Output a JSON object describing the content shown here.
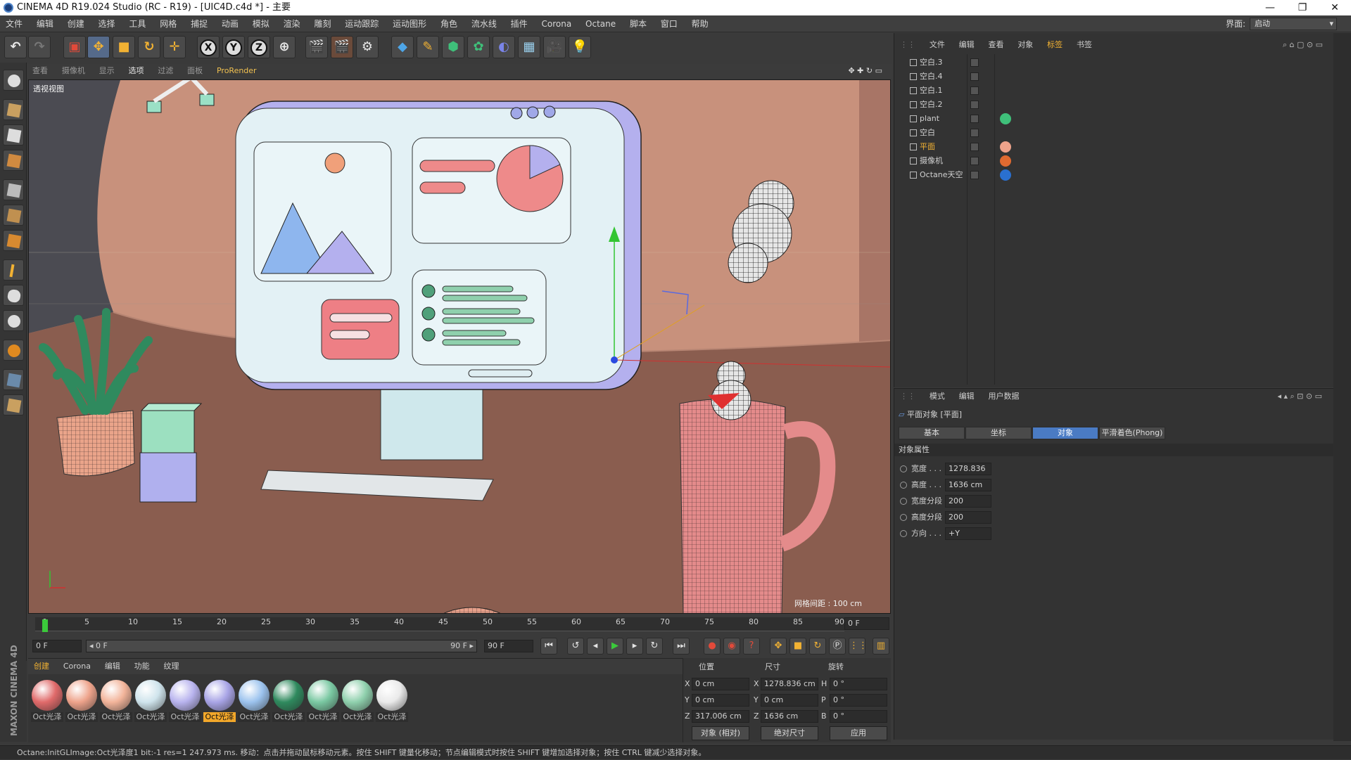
{
  "titlebar": {
    "title": "CINEMA 4D R19.024 Studio (RC - R19) - [UIC4D.c4d *] - 主要",
    "min": "—",
    "restore": "❐",
    "close": "✕"
  },
  "menubar": {
    "items": [
      "文件",
      "编辑",
      "创建",
      "选择",
      "工具",
      "网格",
      "捕捉",
      "动画",
      "模拟",
      "渲染",
      "雕刻",
      "运动跟踪",
      "运动图形",
      "角色",
      "流水线",
      "插件",
      "Corona",
      "Octane",
      "脚本",
      "窗口",
      "帮助"
    ],
    "interface_label": "界面:",
    "interface_value": "启动"
  },
  "toolbar": {
    "x": "X",
    "y": "Y",
    "z": "Z"
  },
  "viewport": {
    "menu": [
      "查看",
      "摄像机",
      "显示",
      "选项",
      "过滤",
      "面板",
      "ProRender"
    ],
    "label": "透视视图",
    "grid_spacing": "网格间距 : 100 cm"
  },
  "timeline": {
    "ticks": [
      "0",
      "5",
      "10",
      "15",
      "20",
      "25",
      "30",
      "35",
      "40",
      "45",
      "50",
      "55",
      "60",
      "65",
      "70",
      "75",
      "80",
      "85",
      "90"
    ],
    "end_field": "0 F"
  },
  "transport": {
    "start": "0 F",
    "range_start": "◂ 0 F",
    "range_end": "90 F ▸",
    "end": "90 F"
  },
  "materials": {
    "menu": [
      "创建",
      "Corona",
      "编辑",
      "功能",
      "纹理"
    ],
    "items": [
      {
        "label": "Oct光泽",
        "color": "#e06a6a",
        "selected": false
      },
      {
        "label": "Oct光泽",
        "color": "#eea38b",
        "selected": false
      },
      {
        "label": "Oct光泽",
        "color": "#f2b49a",
        "selected": false
      },
      {
        "label": "Oct光泽",
        "color": "#cfe4ec",
        "selected": false
      },
      {
        "label": "Oct光泽",
        "color": "#b8b3ee",
        "selected": false
      },
      {
        "label": "Oct光泽",
        "color": "#a8a4e6",
        "selected": true
      },
      {
        "label": "Oct光泽",
        "color": "#9cc3ee",
        "selected": false
      },
      {
        "label": "Oct光泽",
        "color": "#2f8a5e",
        "selected": false
      },
      {
        "label": "Oct光泽",
        "color": "#7ac8a2",
        "selected": false
      },
      {
        "label": "Oct光泽",
        "color": "#8fd0ad",
        "selected": false
      },
      {
        "label": "Oct光泽",
        "color": "#eaeaea",
        "selected": false
      }
    ]
  },
  "coords": {
    "heads": [
      "位置",
      "尺寸",
      "旋转"
    ],
    "rows": [
      {
        "a": "X",
        "pos": "0 cm",
        "b": "X",
        "size": "1278.836 cm",
        "c": "H",
        "rot": "0 °"
      },
      {
        "a": "Y",
        "pos": "0 cm",
        "b": "Y",
        "size": "0 cm",
        "c": "P",
        "rot": "0 °"
      },
      {
        "a": "Z",
        "pos": "317.006 cm",
        "b": "Z",
        "size": "1636 cm",
        "c": "B",
        "rot": "0 °"
      }
    ],
    "mode": "对象 (相对)",
    "size_mode": "绝对尺寸",
    "apply": "应用"
  },
  "objects": {
    "menu": [
      "文件",
      "编辑",
      "查看",
      "对象",
      "标签",
      "书签"
    ],
    "active_menu": "标签",
    "rows": [
      {
        "name": "空白.3",
        "selected": false
      },
      {
        "name": "空白.4",
        "selected": false
      },
      {
        "name": "空白.1",
        "selected": false
      },
      {
        "name": "空白.2",
        "selected": false
      },
      {
        "name": "plant",
        "selected": false
      },
      {
        "name": "空白",
        "selected": false
      },
      {
        "name": "平面",
        "selected": true
      },
      {
        "name": "摄像机",
        "selected": false
      },
      {
        "name": "Octane天空",
        "selected": false
      }
    ]
  },
  "attributes": {
    "menu": [
      "模式",
      "编辑",
      "用户数据"
    ],
    "object": "平面对象 [平面]",
    "tabs": [
      "基本",
      "坐标",
      "对象",
      "平滑着色(Phong)"
    ],
    "active_tab": "对象",
    "section": "对象属性",
    "rows": [
      {
        "label": "宽度 . . .",
        "value": "1278.836"
      },
      {
        "label": "高度 . . .",
        "value": "1636 cm"
      },
      {
        "label": "宽度分段",
        "value": "200"
      },
      {
        "label": "高度分段",
        "value": "200"
      },
      {
        "label": "方向 . . .",
        "value": "+Y"
      }
    ]
  },
  "status": {
    "text": "Octane:InitGLImage:Oct光泽度1  bit:-1 res=1  247.973 ms.    移动：点击并拖动鼠标移动元素。按住 SHIFT 键量化移动；节点编辑模式时按住 SHIFT 键增加选择对象；按住 CTRL 键减少选择对象。"
  },
  "brand": {
    "text": "MAXON CINEMA 4D"
  },
  "colors": {
    "accent": "#f2b233",
    "tab_active": "#4a7bc4",
    "timeline_cursor": "#3bc93b"
  }
}
